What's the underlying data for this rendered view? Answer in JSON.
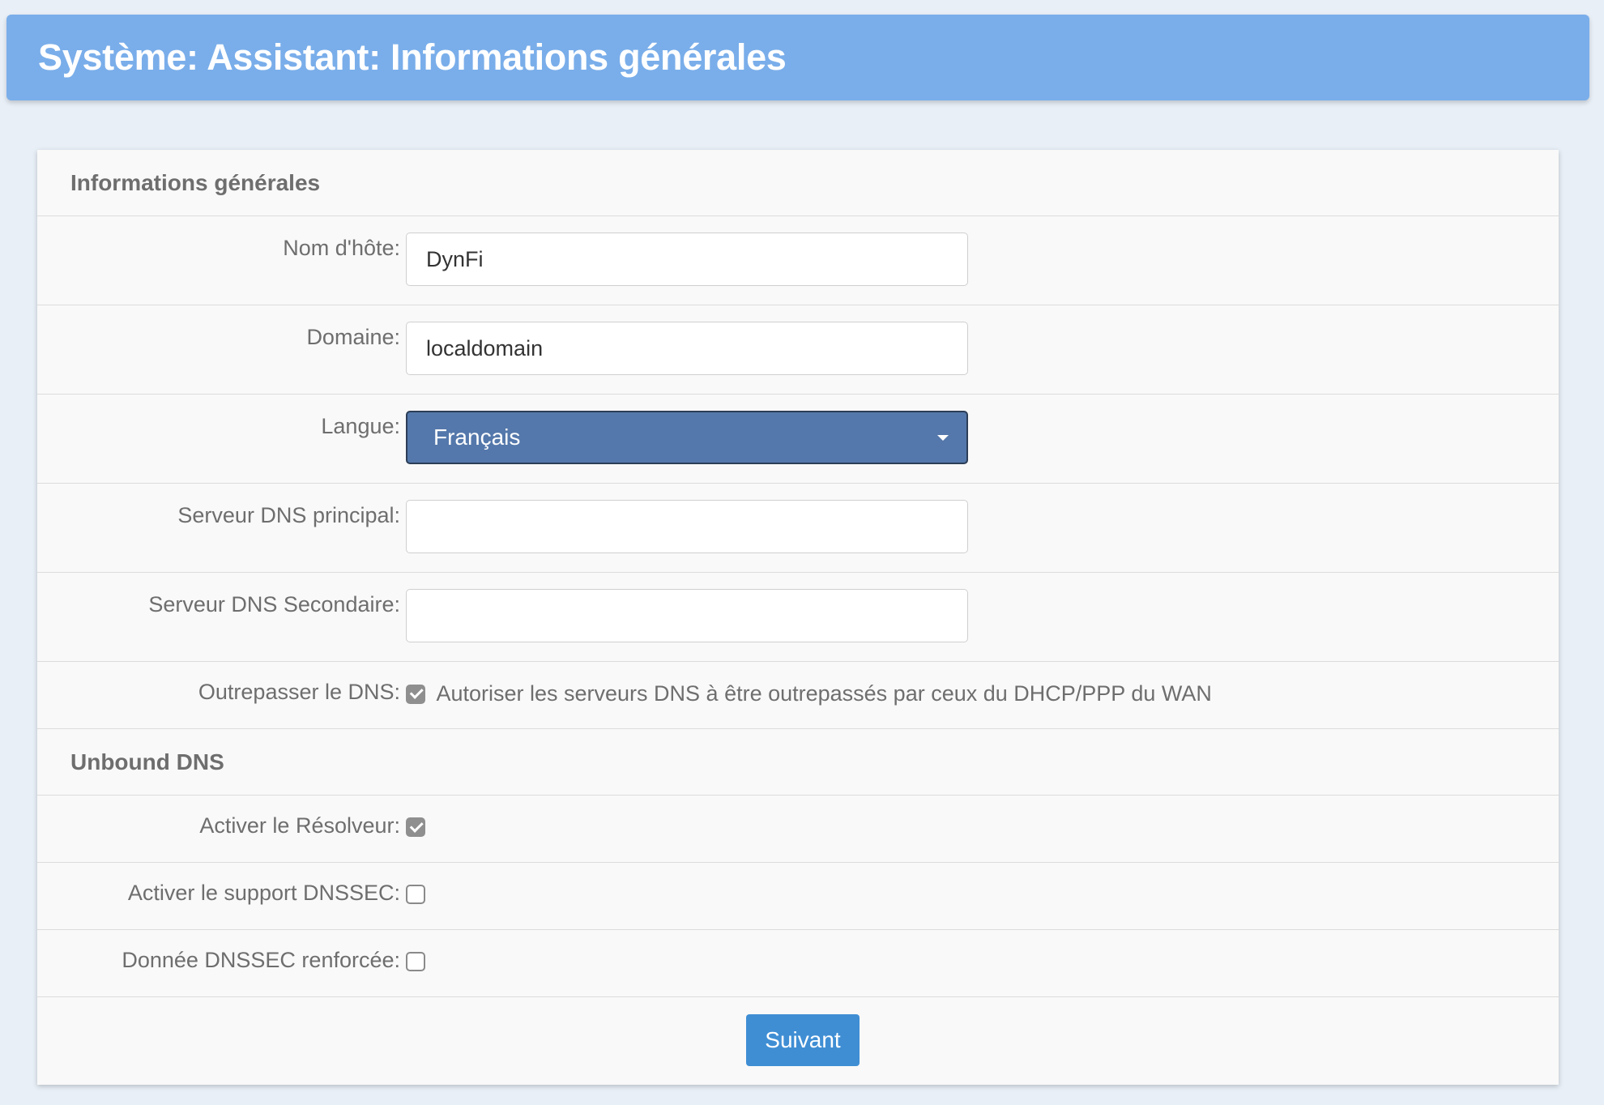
{
  "header": {
    "title": "Système: Assistant: Informations générales"
  },
  "sections": {
    "general": {
      "title": "Informations générales"
    },
    "unbound": {
      "title": "Unbound DNS"
    }
  },
  "fields": {
    "hostname": {
      "label": "Nom d'hôte:",
      "value": "DynFi"
    },
    "domain": {
      "label": "Domaine:",
      "value": "localdomain"
    },
    "language": {
      "label": "Langue:",
      "value": "Français"
    },
    "dns_primary": {
      "label": "Serveur DNS principal:",
      "value": ""
    },
    "dns_secondary": {
      "label": "Serveur DNS Secondaire:",
      "value": ""
    },
    "dns_override": {
      "label": "Outrepasser le DNS:",
      "checkbox_text": "Autoriser les serveurs DNS à être outrepassés par ceux du DHCP/PPP du WAN",
      "checked": true
    },
    "resolver": {
      "label": "Activer le Résolveur:",
      "checked": true
    },
    "dnssec": {
      "label": "Activer le support DNSSEC:",
      "checked": false
    },
    "dnssec_hardened": {
      "label": "Donnée DNSSEC renforcée:",
      "checked": false
    }
  },
  "actions": {
    "next_label": "Suivant"
  },
  "colors": {
    "header_bg": "#7aaeea",
    "select_bg": "#5478ab",
    "button_bg": "#3f8ed4",
    "page_bg": "#e8eff7"
  }
}
